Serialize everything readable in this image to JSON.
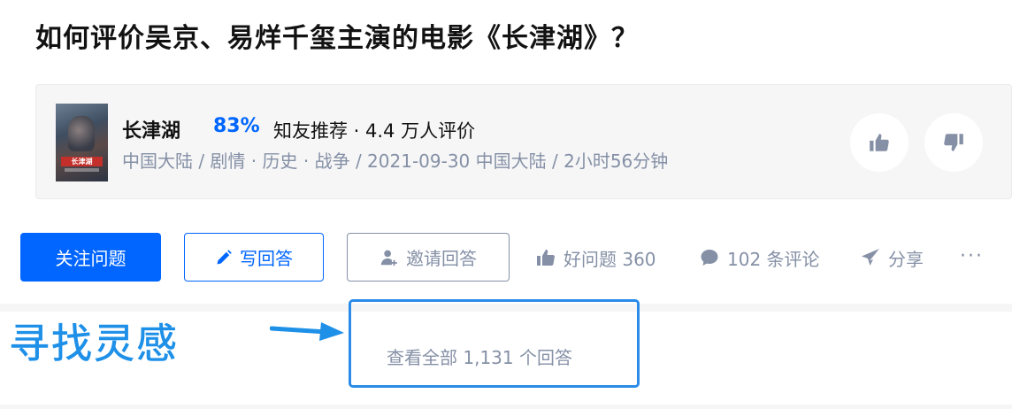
{
  "question": {
    "title": "如何评价吴京、易烊千玺主演的电影《长津湖》？"
  },
  "movie": {
    "poster_title": "长津湖",
    "name": "长津湖",
    "score": "83%",
    "recommend_text": "知友推荐 · 4.4 万人评价",
    "meta": "中国大陆 / 剧情 · 历史 · 战争 / 2021-09-30 中国大陆 / 2小时56分钟",
    "vote_up_icon": "thumbs-up-icon",
    "vote_down_icon": "thumbs-down-icon"
  },
  "actions": {
    "follow_label": "关注问题",
    "write_label": "写回答",
    "invite_label": "邀请回答",
    "good_question": "好问题 360",
    "comments": "102 条评论",
    "share": "分享",
    "more": "···"
  },
  "answers": {
    "view_all": "查看全部 1,131 个回答"
  },
  "annotation": {
    "label": "寻找灵感"
  },
  "colors": {
    "brand_blue": "#0066ff",
    "annotation_blue": "#1e90e8",
    "muted_text": "#8590a6"
  }
}
